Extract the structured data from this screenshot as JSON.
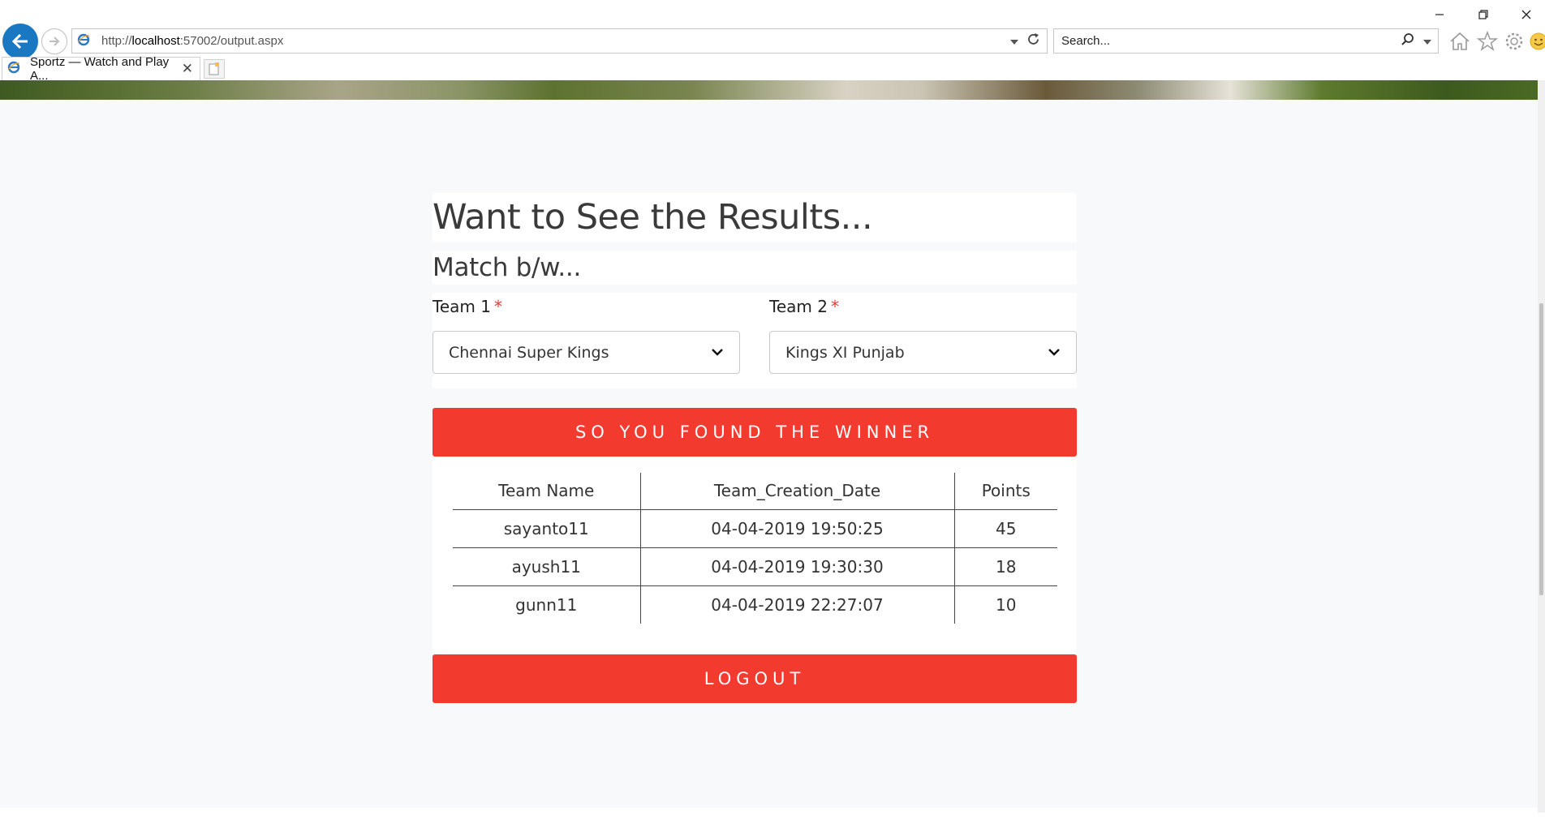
{
  "browser": {
    "url_prefix": "http://",
    "url_host": "localhost",
    "url_rest": ":57002/output.aspx",
    "search_placeholder": "Search...",
    "tab_title": "Sportz — Watch and Play A...",
    "icons": [
      "back-arrow-icon",
      "forward-arrow-icon",
      "ie-logo-icon",
      "dropdown-caret-icon",
      "refresh-icon",
      "search-icon",
      "home-icon",
      "favorites-star-icon",
      "settings-gear-icon",
      "smiley-feedback-icon",
      "close-tab-icon",
      "new-tab-icon",
      "minimize-icon",
      "restore-icon",
      "close-window-icon"
    ]
  },
  "page": {
    "title": "Want to See the Results...",
    "subtitle": "Match b/w...",
    "team1": {
      "label": "Team 1",
      "required_mark": "*",
      "selected": "Chennai Super Kings"
    },
    "team2": {
      "label": "Team 2",
      "required_mark": "*",
      "selected": "Kings XI Punjab"
    },
    "winner_button": "SO YOU FOUND THE WINNER",
    "logout_button": "LOGOUT",
    "accent_color": "#f23a2f"
  },
  "results": {
    "headers": [
      "Team Name",
      "Team_Creation_Date",
      "Points"
    ],
    "rows": [
      [
        "sayanto11",
        "04-04-2019 19:50:25",
        "45"
      ],
      [
        "ayush11",
        "04-04-2019 19:30:30",
        "18"
      ],
      [
        "gunn11",
        "04-04-2019 22:27:07",
        "10"
      ]
    ]
  }
}
